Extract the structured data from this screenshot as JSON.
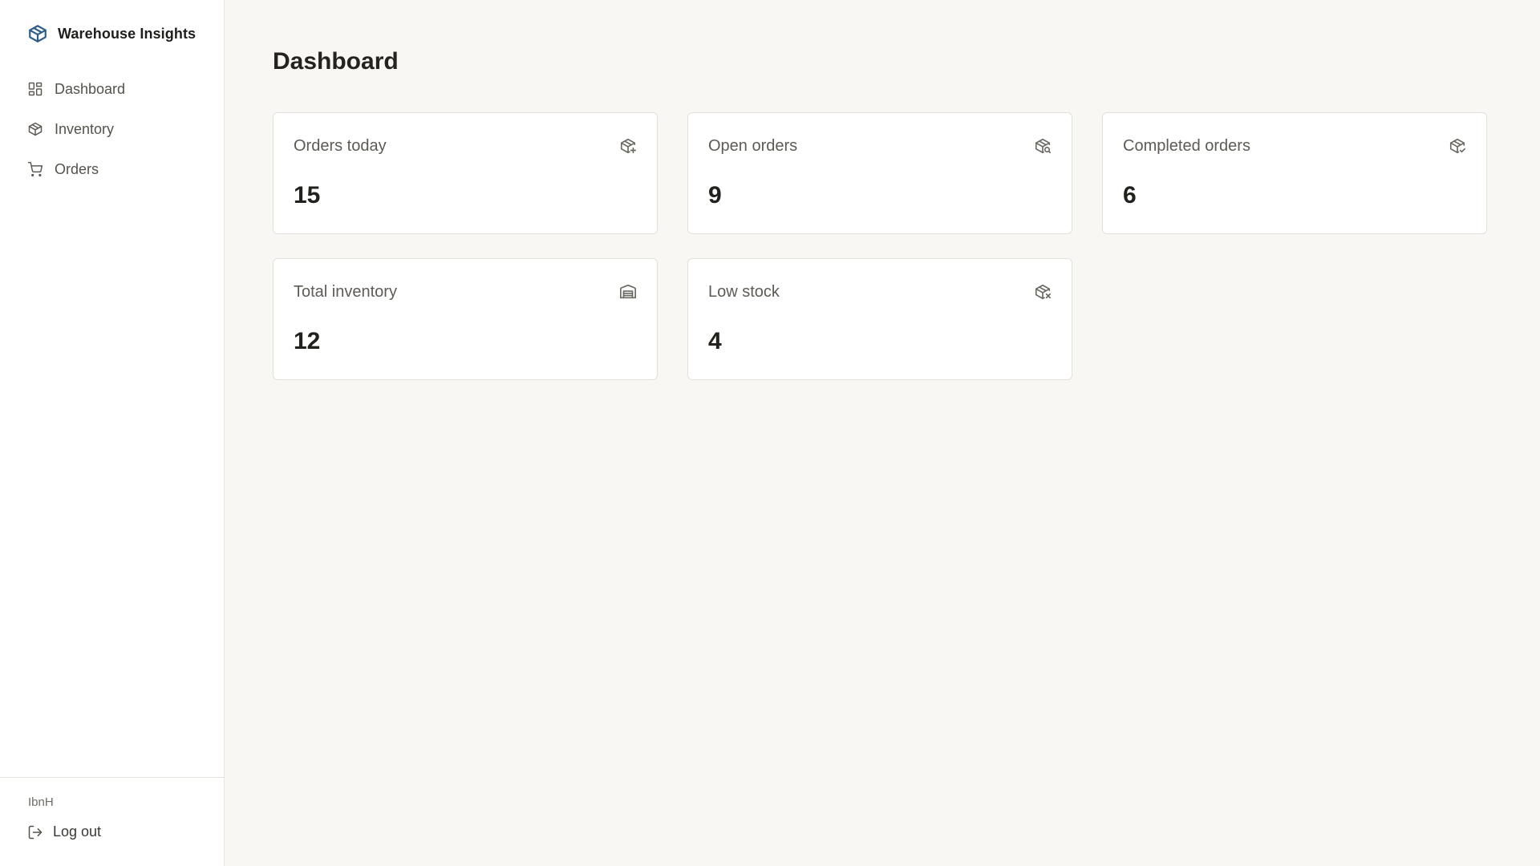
{
  "app": {
    "name": "Warehouse Insights",
    "icon": "package-icon",
    "accent_color": "#2f5d8a"
  },
  "sidebar": {
    "items": [
      {
        "label": "Dashboard",
        "icon": "layout-grid-icon"
      },
      {
        "label": "Inventory",
        "icon": "package-icon"
      },
      {
        "label": "Orders",
        "icon": "shopping-cart-icon"
      }
    ],
    "username": "IbnH",
    "logout_label": "Log out",
    "logout_icon": "log-out-icon"
  },
  "main": {
    "title": "Dashboard",
    "cards": [
      {
        "label": "Orders today",
        "value": "15",
        "icon": "package-plus-icon"
      },
      {
        "label": "Open orders",
        "value": "9",
        "icon": "package-search-icon"
      },
      {
        "label": "Completed orders",
        "value": "6",
        "icon": "package-check-icon"
      },
      {
        "label": "Total inventory",
        "value": "12",
        "icon": "warehouse-icon"
      },
      {
        "label": "Low stock",
        "value": "4",
        "icon": "package-x-icon"
      }
    ]
  }
}
